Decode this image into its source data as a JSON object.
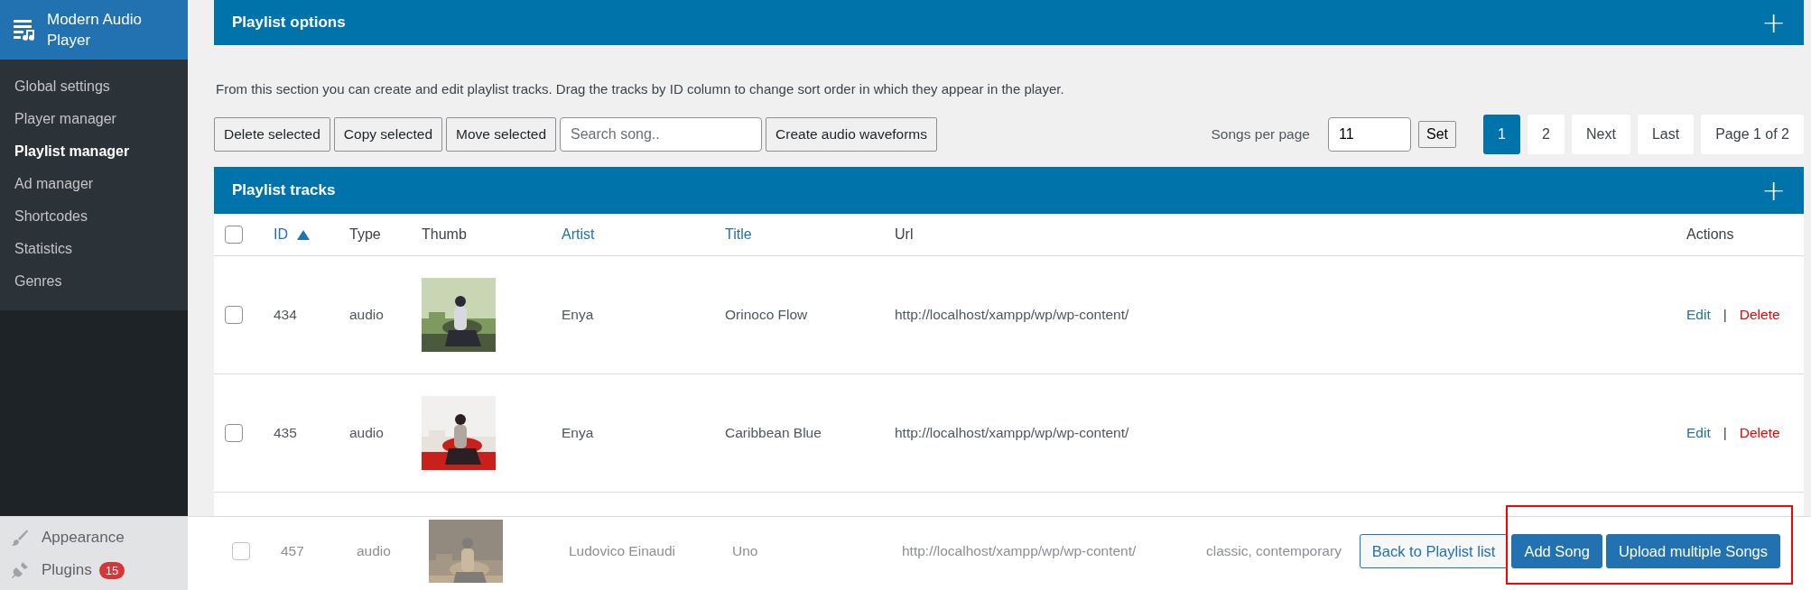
{
  "sidebar": {
    "title": "Modern Audio Player",
    "items": [
      {
        "label": "Global settings",
        "selected": false
      },
      {
        "label": "Player manager",
        "selected": false
      },
      {
        "label": "Playlist manager",
        "selected": true
      },
      {
        "label": "Ad manager",
        "selected": false
      },
      {
        "label": "Shortcodes",
        "selected": false
      },
      {
        "label": "Statistics",
        "selected": false
      },
      {
        "label": "Genres",
        "selected": false
      }
    ],
    "menu": [
      {
        "label": "Appearance",
        "kind": "brush"
      },
      {
        "label": "Plugins",
        "kind": "plug",
        "badge": "15"
      }
    ]
  },
  "options_panel": {
    "title": "Playlist options",
    "toggle": "+"
  },
  "description": "From this section you can create and edit playlist tracks. Drag the tracks by ID column to change sort order in which they appear in the player.",
  "toolbar": {
    "buttons": [
      "Delete selected",
      "Copy selected",
      "Move selected"
    ],
    "search": {
      "placeholder": "Search song.."
    },
    "waveform_button": "Create audio waveforms",
    "per_page_label": "Songs per page",
    "per_page_value": "11",
    "set_button": "Set",
    "pages": [
      {
        "label": "1",
        "selected": true
      },
      {
        "label": "2",
        "selected": false
      },
      {
        "label": "Next",
        "selected": false
      },
      {
        "label": "Last",
        "selected": false
      }
    ],
    "page_info": "Page 1 of 2"
  },
  "tracks_panel": {
    "title": "Playlist tracks",
    "toggle": "+",
    "select_all": {
      "checked": false
    },
    "columns": [
      {
        "label": "ID",
        "link": true,
        "sorted": true
      },
      {
        "label": "Type",
        "link": false,
        "sorted": false
      },
      {
        "label": "Thumb",
        "link": false,
        "sorted": false
      },
      {
        "label": "Artist",
        "link": true,
        "sorted": false
      },
      {
        "label": "Title",
        "link": true,
        "sorted": false
      },
      {
        "label": "Url",
        "link": false,
        "sorted": false
      },
      {
        "label": "Actions",
        "link": false,
        "sorted": false
      }
    ],
    "rows": [
      {
        "checked": false,
        "id": "434",
        "type": "audio",
        "thumb": {
          "kind": "picture"
        },
        "artist": "Enya",
        "title": "Orinoco Flow",
        "url": "http://localhost/xampp/wp/wp-content/",
        "actions": [
          "Edit",
          "|",
          "Delete"
        ]
      },
      {
        "checked": false,
        "id": "435",
        "type": "audio",
        "thumb": {
          "kind": "picture"
        },
        "artist": "Enya",
        "title": "Caribbean Blue",
        "url": "http://localhost/xampp/wp/wp-content/",
        "actions": [
          "Edit",
          "|",
          "Delete"
        ]
      },
      {
        "checked": false,
        "id": "457",
        "type": "audio",
        "thumb": {
          "kind": "picture"
        },
        "artist": "Ludovico Einaudi",
        "title": "Uno",
        "url": "http://localhost/xampp/wp/wp-content/",
        "column_7": "classic, contemporary"
      }
    ]
  },
  "footer_bar": {
    "buttons": [
      {
        "label": "Back to Playlist list",
        "kind": "secondary"
      },
      {
        "label": "Add Song",
        "kind": "primary"
      },
      {
        "label": "Upload multiple Songs",
        "kind": "primary"
      }
    ],
    "annotation": {
      "kind": "highlight-box"
    }
  }
}
